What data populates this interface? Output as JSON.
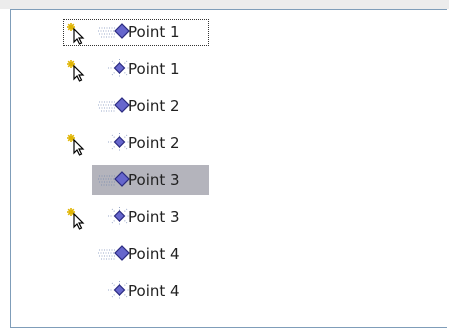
{
  "animation_pane": {
    "items": [
      {
        "label": "Point 1",
        "trigger": true,
        "effect": "fly-in",
        "selected": false,
        "focused": true
      },
      {
        "label": "Point 1",
        "trigger": true,
        "effect": "emphasis",
        "selected": false,
        "focused": false
      },
      {
        "label": "Point 2",
        "trigger": false,
        "effect": "fly-in",
        "selected": false,
        "focused": false
      },
      {
        "label": "Point 2",
        "trigger": true,
        "effect": "emphasis",
        "selected": false,
        "focused": false
      },
      {
        "label": "Point 3",
        "trigger": false,
        "effect": "fly-in",
        "selected": true,
        "focused": false
      },
      {
        "label": "Point 3",
        "trigger": true,
        "effect": "emphasis",
        "selected": false,
        "focused": false
      },
      {
        "label": "Point 4",
        "trigger": false,
        "effect": "fly-in",
        "selected": false,
        "focused": false
      },
      {
        "label": "Point 4",
        "trigger": false,
        "effect": "emphasis",
        "selected": false,
        "focused": false
      }
    ]
  },
  "icons": {
    "trigger": "click-trigger-icon",
    "fly_in": "fly-in-diamond-icon",
    "emphasis": "emphasis-diamond-icon"
  },
  "colors": {
    "diamond_fill": "#6666cc",
    "diamond_stroke": "#2b2b80",
    "selection": "#b4b4bc",
    "trigger_star": "#e0b400"
  }
}
